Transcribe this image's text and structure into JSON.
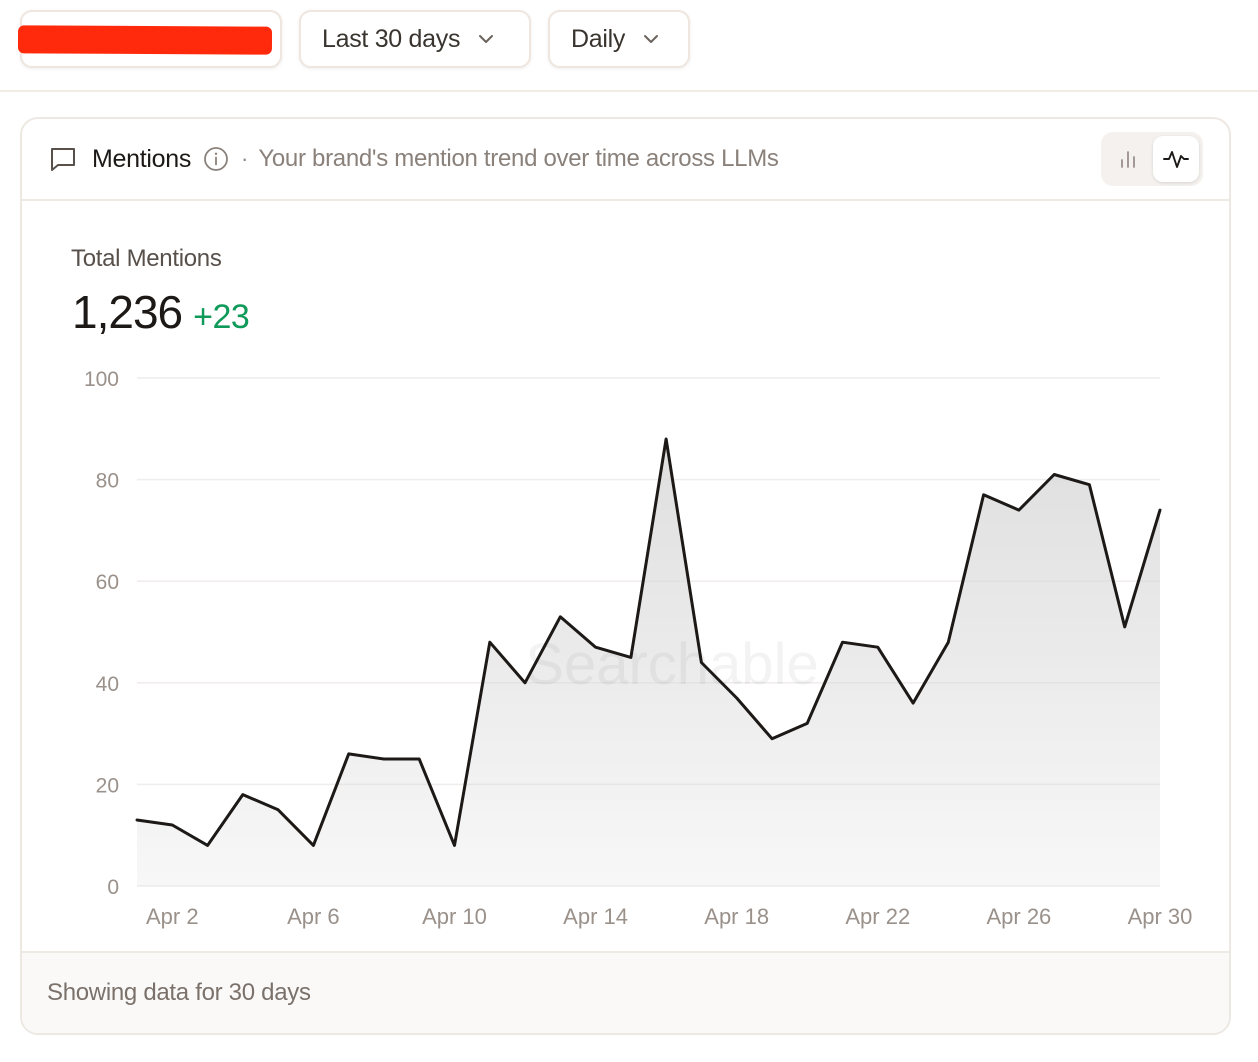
{
  "filters": {
    "range_label": "Last 30 days",
    "granularity_label": "Daily"
  },
  "card": {
    "title": "Mentions",
    "separator": "·",
    "description": "Your brand's mention trend over time across LLMs",
    "view_modes": [
      "bar-chart-icon",
      "line-chart-icon"
    ],
    "active_view": "line-chart-icon",
    "footer": "Showing data for 30 days"
  },
  "stats": {
    "label": "Total Mentions",
    "value": "1,236",
    "delta": "+23",
    "delta_color": "#0f9a5a"
  },
  "chart_data": {
    "type": "area",
    "x": [
      "Apr 1",
      "Apr 2",
      "Apr 3",
      "Apr 4",
      "Apr 5",
      "Apr 6",
      "Apr 7",
      "Apr 8",
      "Apr 9",
      "Apr 10",
      "Apr 11",
      "Apr 12",
      "Apr 13",
      "Apr 14",
      "Apr 15",
      "Apr 16",
      "Apr 17",
      "Apr 18",
      "Apr 19",
      "Apr 20",
      "Apr 21",
      "Apr 22",
      "Apr 23",
      "Apr 24",
      "Apr 25",
      "Apr 26",
      "Apr 27",
      "Apr 28",
      "Apr 29",
      "Apr 30"
    ],
    "values": [
      13,
      12,
      8,
      18,
      15,
      8,
      26,
      25,
      25,
      8,
      48,
      40,
      53,
      47,
      45,
      88,
      44,
      37,
      29,
      32,
      48,
      47,
      36,
      48,
      77,
      74,
      81,
      79,
      51,
      74
    ],
    "x_tick_labels": [
      "Apr 2",
      "Apr 6",
      "Apr 10",
      "Apr 14",
      "Apr 18",
      "Apr 22",
      "Apr 26",
      "Apr 30"
    ],
    "y_ticks": [
      0,
      20,
      40,
      60,
      80,
      100
    ],
    "ylim": [
      0,
      100
    ],
    "grid": true,
    "line_color": "#1c1917",
    "fill_color": "#d9d9d9"
  }
}
